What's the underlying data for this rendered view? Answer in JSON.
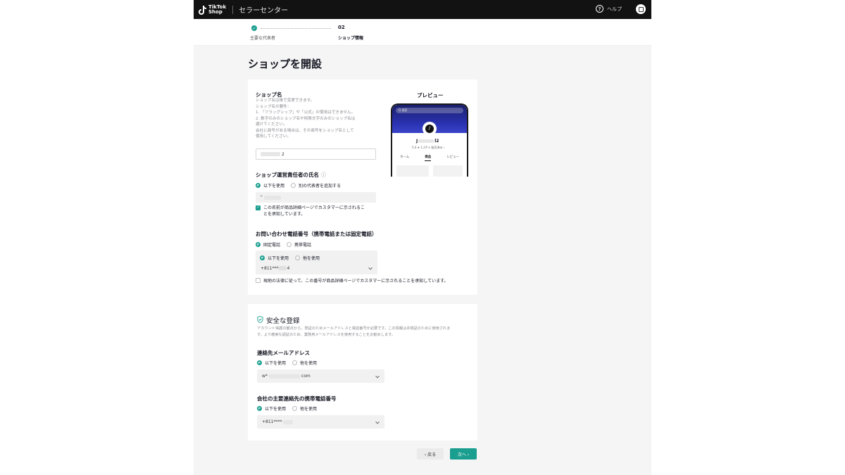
{
  "topbar": {
    "logo_line1": "TikTok",
    "logo_line2": "Shop",
    "section_title": "セラーセンター",
    "help_label": "ヘルプ",
    "help_glyph": "?"
  },
  "stepper": {
    "step1_mark": "✓",
    "step1_label": "主要な代表者",
    "step2_number": "02",
    "step2_label": "ショップ情報"
  },
  "page_title": "ショップを開設",
  "shop_name": {
    "label": "ショップ名",
    "help_lines": [
      "ショップ名は後で変更できます。",
      "ショップ名の要件：",
      "1. 「フラッグシップ」や「公式」の使用はできません。",
      "2. 数字のみのショップ名や特殊文字のみのショップ名は",
      "避けてください。",
      "会社に商号がある場合は、その商号をショップ名として",
      "使用してください。"
    ],
    "value_suffix": "2"
  },
  "operator": {
    "label": "ショップ運営責任者の氏名",
    "info_glyph": "ⓘ",
    "option_use": "以下を使用",
    "option_add": "別の代表者を追加する",
    "value_prefix": "\"",
    "consent_line1": "この名前が商品詳細ページでカスタマーに示されるこ",
    "consent_line2": "とを承知しています。",
    "consent_mark": "✓"
  },
  "contact_phone": {
    "label": "お問い合わせ電話番号（携帯電話または固定電話）",
    "option_landline": "固定電話",
    "option_mobile": "携帯電話",
    "option_use": "以下を使用",
    "option_other": "他を使用",
    "value_prefix": "+811***",
    "value_suffix": "4",
    "consent": "現地の法律に従って、この番号が商品詳細ページでカスタマーに示されることを承知しています。"
  },
  "preview": {
    "title": "プレビュー",
    "search_text": "Q 検索",
    "shop_name_start": "J",
    "shop_name_end": "l2",
    "rating": "5.0 ★  1.2千+ 販売済み ›",
    "tabs": [
      "ホーム",
      "商品",
      "レビュー"
    ],
    "avatar_glyph": "♪"
  },
  "secure": {
    "title": "安全な登録",
    "desc_line1": "アカウント保護の観点から、弊証のためメールアドレスと電話番号が必要です。この情報は本検証のために使用されま",
    "desc_line2": "す。より確実な認証のため、業務用メールアドレスを使用することをお勧めします。",
    "email_label": "連絡先メールアドレス",
    "email_option_use": "以下を使用",
    "email_option_other": "他を使用",
    "email_prefix": "w*",
    "email_suffix": "com",
    "phone_label": "会社の主要連絡先の携帯電話番号",
    "phone_option_use": "以下を使用",
    "phone_option_other": "他を使用",
    "phone_prefix": "+811****"
  },
  "footer": {
    "back_label": "‹  戻る",
    "next_label": "次へ  ›"
  },
  "colors": {
    "accent": "#1a9e8f",
    "topbar": "#121212"
  }
}
